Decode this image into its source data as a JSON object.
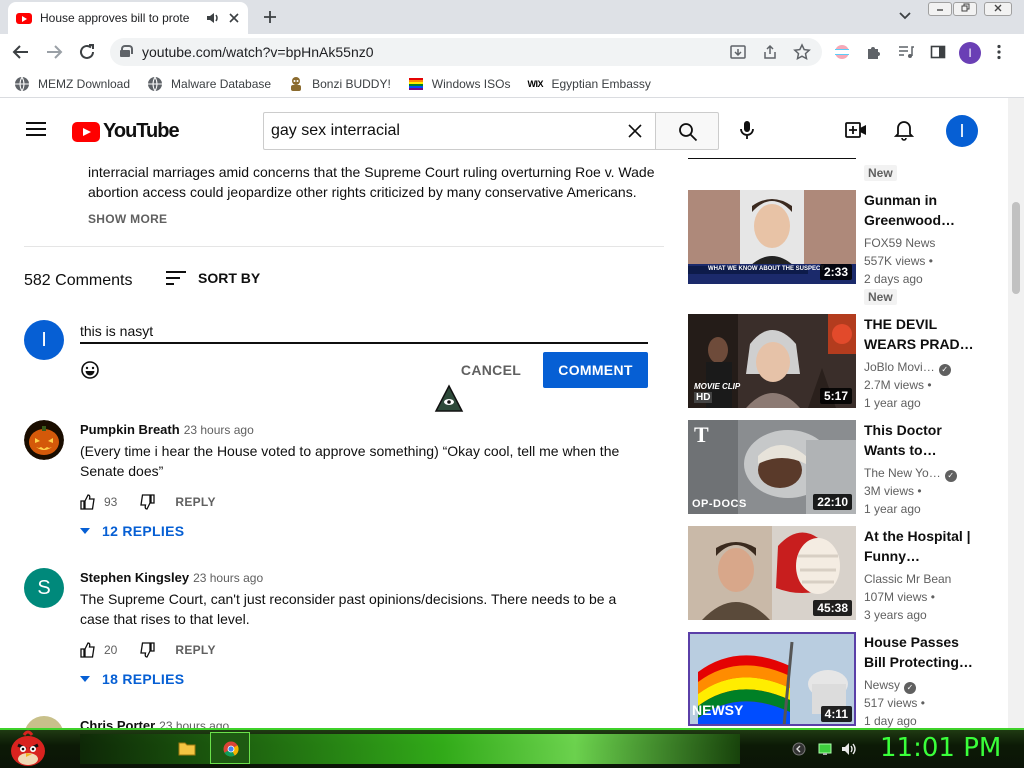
{
  "browser": {
    "tab_title": "House approves bill to prote",
    "url": "youtube.com/watch?v=bpHnAk55nz0",
    "profile_initial": "I",
    "bookmarks": [
      "MEMZ Download",
      "Malware Database",
      "Bonzi BUDDY!",
      "Windows ISOs",
      "Egyptian Embassy"
    ],
    "bookmark_icons": [
      "globe-icon",
      "globe-icon",
      "bonzi-icon",
      "windows-flag-icon",
      "wix-icon"
    ],
    "wix_glyph": "WIX"
  },
  "youtube": {
    "logo_text": "YouTube",
    "search_value": "gay sex interracial",
    "avatar_initial": "I"
  },
  "description": {
    "text": "interracial marriages amid concerns that the Supreme Court ruling overturning Roe v. Wade abortion access could jeopardize other rights criticized by many conservative Americans.",
    "show_more": "SHOW MORE"
  },
  "comments": {
    "count_label": "582 Comments",
    "sort_label": "SORT BY",
    "draft_value": "this is nasyt",
    "my_initial": "I",
    "cancel_label": "CANCEL",
    "comment_label": "COMMENT",
    "reply_label": "REPLY",
    "items": [
      {
        "author": "Pumpkin Breath",
        "time": "23 hours ago",
        "text": "(Every time i hear the House voted to approve something) “Okay cool, tell me when the Senate does”",
        "likes": "93",
        "replies": "12 REPLIES"
      },
      {
        "author": "Stephen Kingsley",
        "time": "23 hours ago",
        "avatar_letter": "S",
        "text": "The Supreme Court, can't just reconsider past opinions/decisions. There needs to be a case that rises to that level.",
        "likes": "20",
        "replies": "18 REPLIES"
      },
      {
        "author": "Chris Porter",
        "time": "23 hours ago"
      }
    ]
  },
  "related": [
    {
      "badge": "New"
    },
    {
      "title": "Gunman in Greenwood…",
      "channel": "FOX59 News",
      "views": "557K views",
      "age": "2 days ago",
      "badge": "New",
      "duration": "2:33",
      "thumb_caption": "WHAT WE KNOW ABOUT THE SUSPECT"
    },
    {
      "title": "THE DEVIL WEARS PRAD…",
      "channel": "JoBlo Movi…",
      "views": "2.7M views",
      "age": "1 year ago",
      "duration": "5:17",
      "thumb_caption": "MOVIE CLIP",
      "thumb_caption2": "HD"
    },
    {
      "title": "This Doctor Wants to…",
      "channel": "The New Yo…",
      "views": "3M views",
      "age": "1 year ago",
      "duration": "22:10",
      "thumb_caption": "OP-DOCS",
      "logo_glyph": "T"
    },
    {
      "title": "At the Hospital | Funny…",
      "channel": "Classic Mr Bean",
      "views": "107M views",
      "age": "3 years ago",
      "duration": "45:38"
    },
    {
      "title": "House Passes Bill Protecting…",
      "channel": "Newsy",
      "views": "517 views",
      "age": "1 day ago",
      "duration": "4:11",
      "thumb_caption": "NEWSY"
    }
  ],
  "taskbar": {
    "clock": "11:01 PM"
  },
  "colors": {
    "accent": "#065fd4",
    "youtube_red": "#ff0000",
    "clock_green": "#3aff3a"
  }
}
